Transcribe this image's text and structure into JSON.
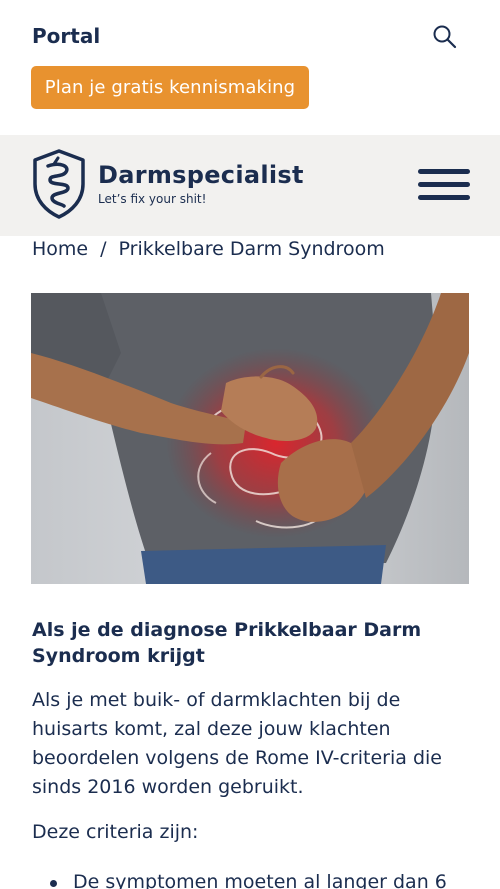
{
  "topbar": {
    "portal_label": "Portal",
    "cta_label": "Plan je gratis kennismaking",
    "search_icon": "search-icon"
  },
  "brand": {
    "name": "Darmspecialist",
    "tagline": "Let’s fix your shit!",
    "logo_icon": "intestine-shield-icon",
    "menu_icon": "hamburger-menu-icon"
  },
  "breadcrumb": {
    "home": "Home",
    "separator": "/",
    "current": "Prikkelbare Darm Syndroom"
  },
  "hero": {
    "image": "person-holding-stomach-with-intestine-illustration"
  },
  "article": {
    "heading": "Als je de diagnose Prikkelbaar Darm Syndroom krijgt",
    "paragraph1": "Als je met buik- of darmklachten bij de huisarts komt, zal deze jouw klachten beoordelen volgens de Rome IV-criteria die sinds 2016 worden gebruikt.",
    "paragraph2": "Deze criteria zijn:",
    "bullet1": "De symptomen moeten al langer dan 6"
  },
  "colors": {
    "navy": "#1b2d4f",
    "accent": "#e8922f",
    "brandbar_bg": "#f2f1ef"
  }
}
